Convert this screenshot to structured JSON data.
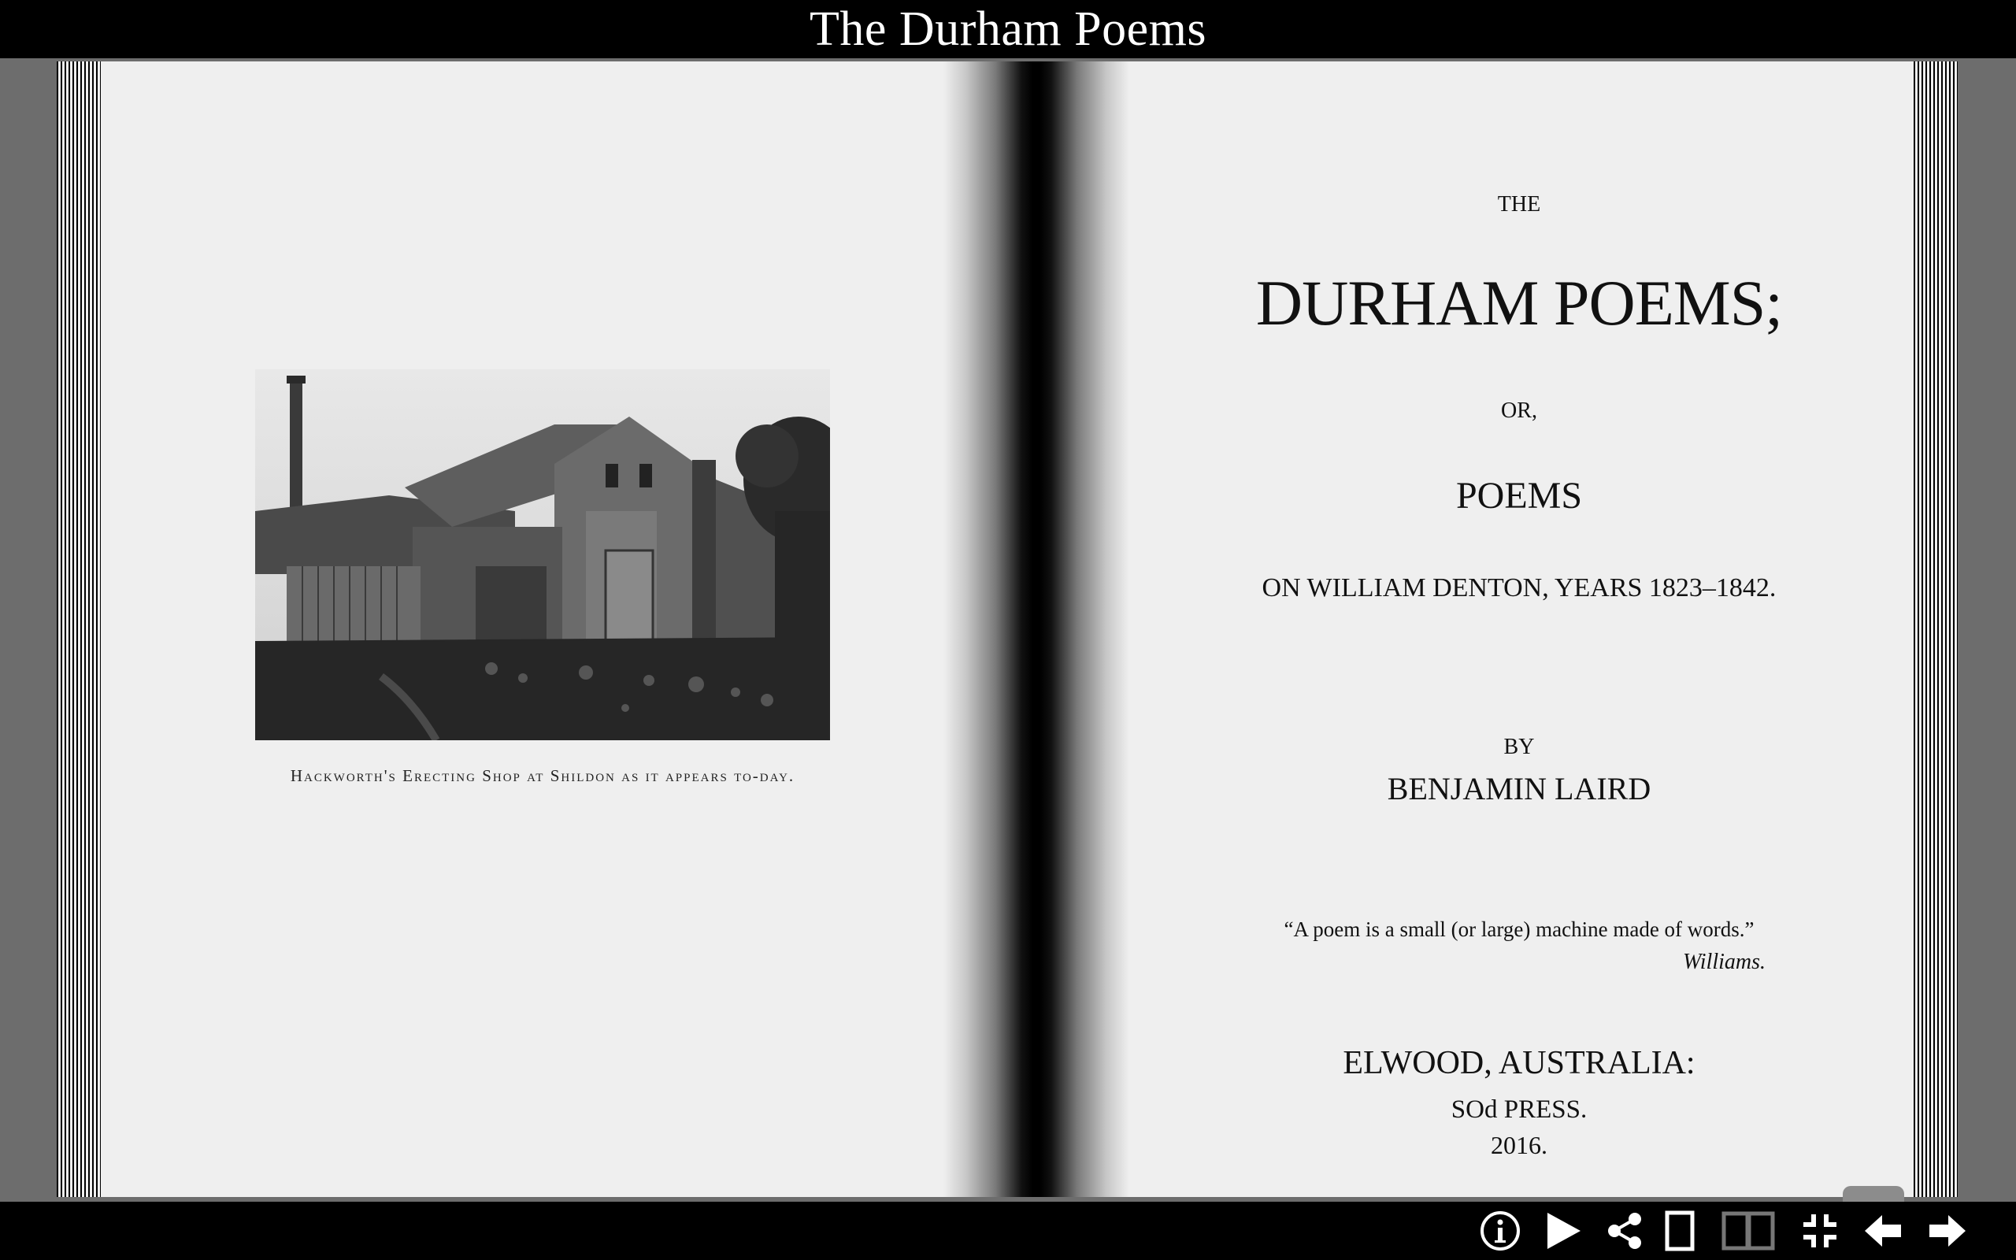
{
  "app": {
    "title": "The Durham Poems"
  },
  "left_page": {
    "image_icon": "photograph-icon",
    "caption": "Hackworth's Erecting Shop at Shildon as it appears to-day."
  },
  "right_page": {
    "the": "THE",
    "title": "DURHAM POEMS;",
    "or": "OR,",
    "poems": "POEMS",
    "subtitle": "ON WILLIAM DENTON, YEARS 1823–1842.",
    "by": "BY",
    "author": "BENJAMIN LAIRD",
    "quote": "“A poem is a small (or large) machine made of words.”",
    "quote_attribution": "Williams.",
    "place": "ELWOOD, AUSTRALIA:",
    "press": "SOd PRESS.",
    "year": "2016."
  },
  "toolbar": {
    "buttons": [
      {
        "icon": "info-icon"
      },
      {
        "icon": "play-icon"
      },
      {
        "icon": "share-icon"
      },
      {
        "icon": "single-page-icon"
      },
      {
        "icon": "double-page-icon"
      },
      {
        "icon": "exit-fullscreen-icon"
      },
      {
        "icon": "arrow-left-icon"
      },
      {
        "icon": "arrow-right-icon"
      }
    ]
  },
  "colors": {
    "bars": "#000000",
    "page": "#efefef",
    "backdrop": "#6d6d6d",
    "toolbar_icon": "#ffffff",
    "toolbar_icon_inactive": "#777777"
  }
}
